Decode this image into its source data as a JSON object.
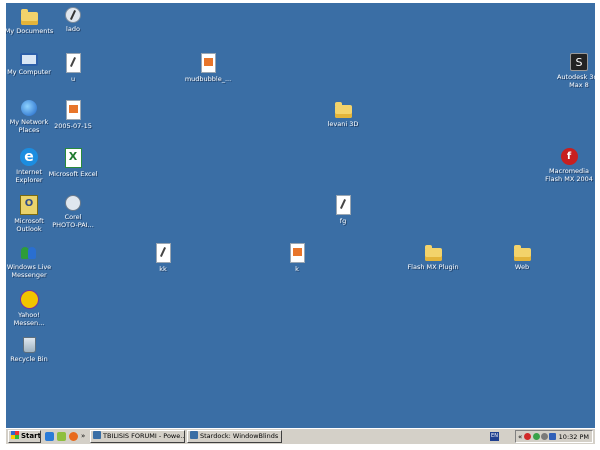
{
  "desktop": {
    "background": "#3a6ea5",
    "icons": {
      "my_documents": {
        "label": "My Documents",
        "icon": "folder-icon"
      },
      "lado": {
        "label": "lado",
        "icon": "shortcut-icon"
      },
      "my_computer": {
        "label": "My Computer",
        "icon": "computer-icon"
      },
      "u": {
        "label": "u",
        "icon": "document-icon"
      },
      "mudbubble": {
        "label": "mudbubble_...",
        "icon": "image-file-icon"
      },
      "autodesk": {
        "label": "Autodesk 3ds\nMax 8",
        "icon": "autodesk-icon"
      },
      "my_network_places": {
        "label": "My Network\nPlaces",
        "icon": "network-icon"
      },
      "date_file": {
        "label": "2005-07-15",
        "icon": "image-file-icon"
      },
      "levani_3d": {
        "label": "levani 3D",
        "icon": "folder-icon"
      },
      "internet_explorer": {
        "label": "Internet\nExplorer",
        "icon": "ie-icon"
      },
      "microsoft_excel": {
        "label": "Microsoft Excel",
        "icon": "excel-icon"
      },
      "macromedia_flash": {
        "label": "Macromedia\nFlash MX 2004",
        "icon": "flash-icon"
      },
      "microsoft_outlook": {
        "label": "Microsoft\nOutlook",
        "icon": "outlook-icon"
      },
      "corel": {
        "label": "Corel\nPHOTO-PAI...",
        "icon": "corel-icon"
      },
      "fg": {
        "label": "fg",
        "icon": "shortcut-icon"
      },
      "windows_live_messenger": {
        "label": "Windows Live\nMessenger",
        "icon": "messenger-icon"
      },
      "kk": {
        "label": "kk",
        "icon": "shortcut-icon"
      },
      "k": {
        "label": "k",
        "icon": "image-file-icon"
      },
      "flash_mx_plugin": {
        "label": "Flash MX Plugin",
        "icon": "folder-icon"
      },
      "web": {
        "label": "Web",
        "icon": "folder-icon"
      },
      "yahoo_messenger": {
        "label": "Yahoo!\nMessen...",
        "icon": "yahoo-icon"
      },
      "recycle_bin": {
        "label": "Recycle Bin",
        "icon": "recycle-bin-icon"
      }
    }
  },
  "taskbar": {
    "start_label": "Start",
    "quick_launch_chevron": "»",
    "tasks": [
      {
        "label": "TBILISIS FORUMI - Powe...",
        "icon": "ie-icon"
      },
      {
        "label": "Stardock: WindowBlinds ...",
        "icon": "ie-icon"
      }
    ],
    "language": "EN",
    "tray_chevron": "«",
    "clock": "10:32 PM"
  }
}
